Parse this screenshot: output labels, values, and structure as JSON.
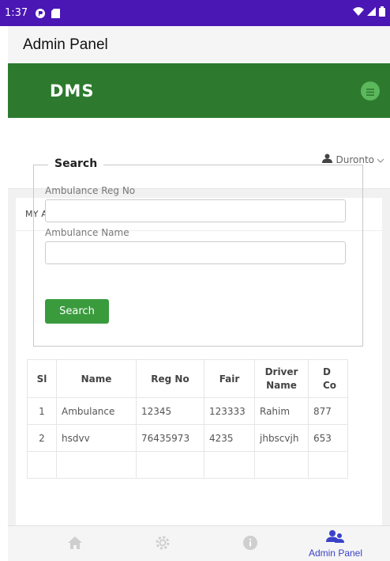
{
  "status_bar": {
    "time": "1:37",
    "icons": [
      "notification-app-icon",
      "sd-card-icon",
      "wifi-icon",
      "signal-icon",
      "battery-icon"
    ]
  },
  "app_bar": {
    "title": "Admin Panel"
  },
  "brand": {
    "name": "DMS",
    "color": "#2d7a2f"
  },
  "user_menu": {
    "name": "Duronto"
  },
  "panel": {
    "heading": "MY AMBULANCES"
  },
  "search": {
    "legend": "Search",
    "reg_no_label": "Ambulance Reg No",
    "reg_no_value": "",
    "name_label": "Ambulance Name",
    "name_value": "",
    "button_label": "Search",
    "button_color": "#3a9b3d"
  },
  "table": {
    "headers": [
      "Sl",
      "Name",
      "Reg No",
      "Fair",
      "Driver Name",
      "D Co"
    ],
    "rows": [
      [
        "1",
        "Ambulance",
        "12345",
        "123333",
        "Rahim",
        "877"
      ],
      [
        "2",
        "hsdvv",
        "76435973",
        "4235",
        "jhbscvjh",
        "653"
      ]
    ]
  },
  "bottom_nav": {
    "items": [
      {
        "icon": "home-icon",
        "label": ""
      },
      {
        "icon": "settings-icon",
        "label": ""
      },
      {
        "icon": "info-icon",
        "label": ""
      },
      {
        "icon": "admin-users-icon",
        "label": "Admin Panel",
        "active": true
      }
    ],
    "active_color": "#3b42c9"
  }
}
